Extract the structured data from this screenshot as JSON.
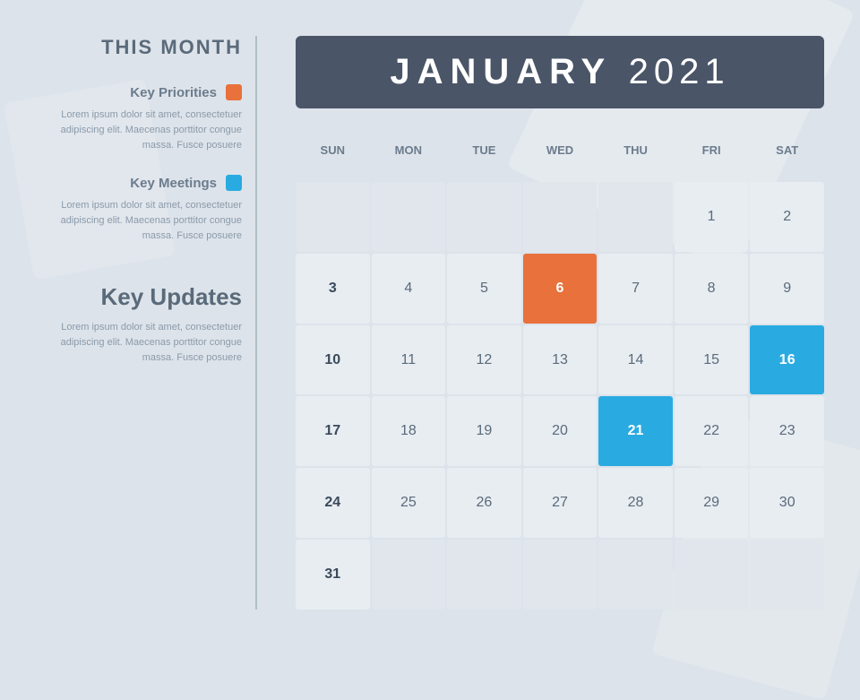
{
  "sidebar": {
    "title": "THIS MONTH",
    "key_priorities": {
      "label": "Key Priorities",
      "badge_color": "orange",
      "text": "Lorem ipsum dolor sit amet, consectetuer adipiscing elit. Maecenas porttitor congue massa. Fusce posuere"
    },
    "key_meetings": {
      "label": "Key Meetings",
      "badge_color": "blue",
      "text": "Lorem ipsum dolor sit amet, consectetuer adipiscing elit. Maecenas porttitor congue massa. Fusce posuere"
    },
    "key_updates": {
      "title": "Key Updates",
      "text": "Lorem ipsum dolor sit amet, consectetuer adipiscing elit. Maecenas porttitor congue massa. Fusce posuere"
    }
  },
  "calendar": {
    "month": "JANUARY",
    "year": "2021",
    "days_header": [
      "SUN",
      "MON",
      "TUE",
      "WED",
      "THU",
      "FRI",
      "SAT"
    ],
    "weeks": [
      [
        null,
        null,
        null,
        null,
        null,
        1,
        2
      ],
      [
        3,
        4,
        5,
        6,
        7,
        8,
        9
      ],
      [
        10,
        11,
        12,
        13,
        14,
        15,
        16
      ],
      [
        17,
        18,
        19,
        20,
        21,
        22,
        23
      ],
      [
        24,
        25,
        26,
        27,
        28,
        29,
        30
      ],
      [
        31,
        null,
        null,
        null,
        null,
        null,
        null
      ]
    ],
    "highlights": {
      "orange": [
        6
      ],
      "blue": [
        16,
        21
      ]
    }
  }
}
